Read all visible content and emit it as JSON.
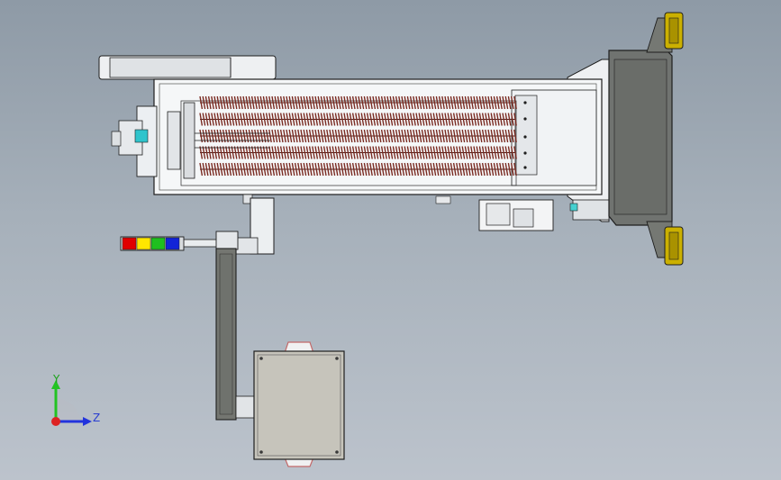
{
  "app": {
    "view": "cad-3d-model-viewport"
  },
  "triad": {
    "y_label": "Y",
    "z_label": "Z",
    "colors": {
      "y": "#22c322",
      "z": "#2233dd",
      "x": "#dd2222"
    }
  },
  "palette": {
    "housing": "#f4f6f8",
    "outline": "#1e1e1e",
    "heater_coil": "#7a2b22",
    "dark_gray": "#6c6f6b",
    "cabinet": "#c2c0b6",
    "mount_pad": "#d1b500",
    "signal_tower": [
      "#e00000",
      "#ffe600",
      "#1fbf1f",
      "#1224d8"
    ]
  },
  "heater": {
    "coil_rows": 5
  }
}
